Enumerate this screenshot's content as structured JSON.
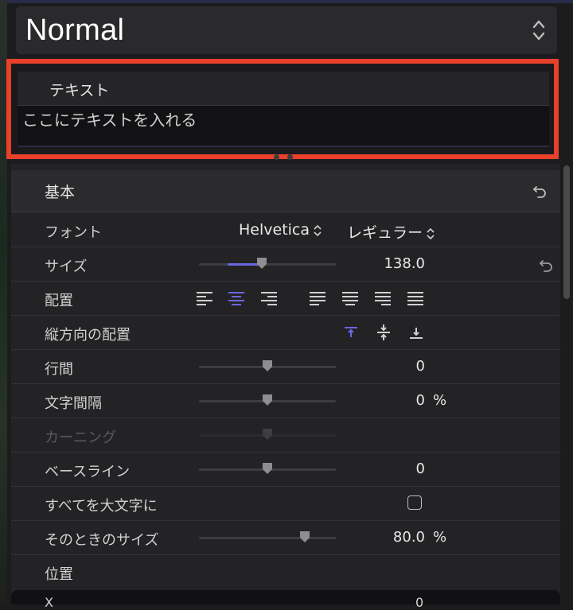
{
  "preset": {
    "value": "Normal"
  },
  "text_section": {
    "title": "テキスト",
    "content": "ここにテキストを入れる"
  },
  "basic_section": {
    "title": "基本",
    "rows": {
      "font": {
        "label": "フォント",
        "family": "Helvetica",
        "style": "レギュラー"
      },
      "size": {
        "label": "サイズ",
        "value": "138.0",
        "slider_fraction": 0.5
      },
      "alignment": {
        "label": "配置",
        "selected": "center"
      },
      "vertical_alignment": {
        "label": "縦方向の配置",
        "selected": "top"
      },
      "line_spacing": {
        "label": "行間",
        "value": "0",
        "slider_fraction": 0.5
      },
      "tracking": {
        "label": "文字間隔",
        "value": "0",
        "unit": "%",
        "slider_fraction": 0.5
      },
      "kerning": {
        "label": "カーニング",
        "disabled": true,
        "slider_fraction": 0.5
      },
      "baseline": {
        "label": "ベースライン",
        "value": "0",
        "slider_fraction": 0.5
      },
      "all_caps": {
        "label": "すべてを大文字に",
        "checked": false
      },
      "all_caps_size": {
        "label": "そのときのサイズ",
        "value": "80.0",
        "unit": "%",
        "slider_fraction": 0.8
      },
      "position": {
        "label": "位置"
      }
    },
    "next_row": {
      "label": "X",
      "value": "0"
    }
  },
  "colors": {
    "accent": "#6a67e0",
    "highlight_border": "#e8402a",
    "background": "#1c1c1e"
  },
  "icons": {
    "stepper": "updown-chevron-icon",
    "reset": "reset-arrow-icon",
    "align": [
      "align-left-icon",
      "align-center-icon",
      "align-right-icon",
      "justify-left-icon",
      "justify-center-icon",
      "justify-right-icon",
      "justify-full-icon"
    ],
    "valign": [
      "valign-top-icon",
      "valign-middle-icon",
      "valign-bottom-icon"
    ]
  }
}
